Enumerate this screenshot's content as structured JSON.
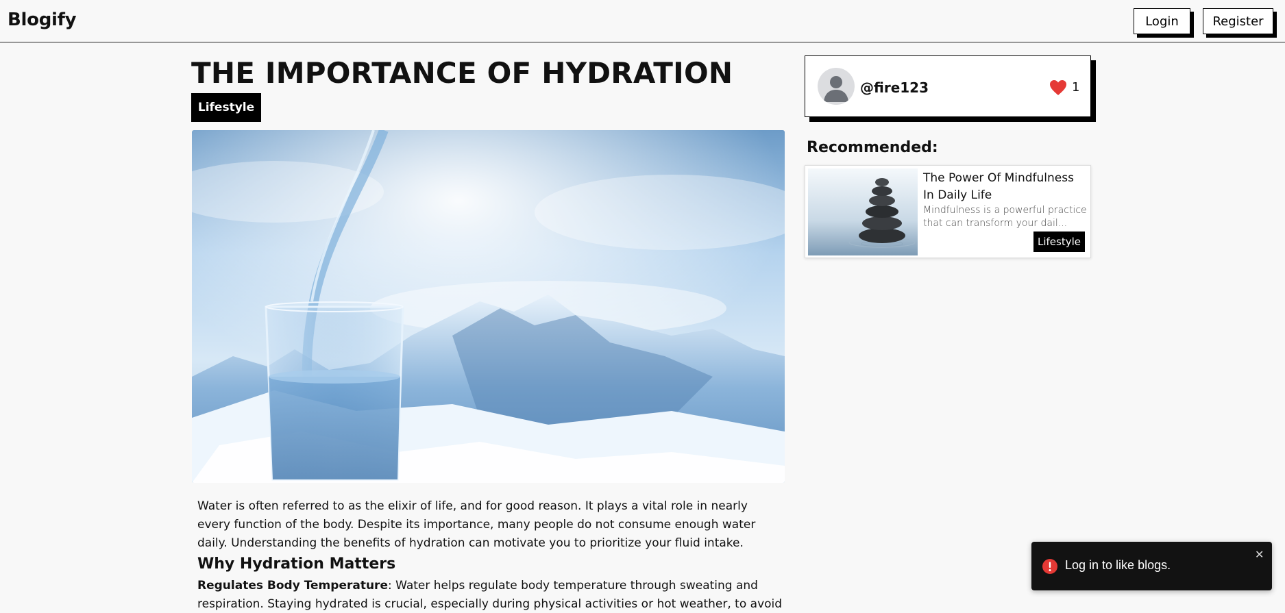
{
  "header": {
    "brand": "Blogify",
    "login_label": "Login",
    "register_label": "Register"
  },
  "article": {
    "title": "THE IMPORTANCE OF HYDRATION",
    "category": "Lifestyle",
    "hero_alt": "Water pouring into a glass in front of snowy mountains",
    "intro": "Water is often referred to as the elixir of life, and for good reason. It plays a vital role in nearly every function of the body. Despite its importance, many people do not consume enough water daily. Understanding the benefits of hydration can motivate you to prioritize your fluid intake.",
    "section_heading": "Why Hydration Matters",
    "point_label": "Regulates Body Temperature",
    "point_text": ": Water helps regulate body temperature through sweating and respiration. Staying hydrated is crucial, especially during physical activities or hot weather, to avoid overheating."
  },
  "author": {
    "username": "@fire123",
    "avatar_icon": "user-avatar-icon",
    "like_icon": "heart-icon",
    "like_color": "#e53935",
    "likes": "1"
  },
  "recommended": {
    "heading": "Recommended:",
    "items": [
      {
        "title": "The Power Of Mindfulness In Daily Life",
        "excerpt": "Mindfulness is a powerful practice that can transform your dail...",
        "category": "Lifestyle",
        "thumb_alt": "Stacked stones balanced above calm water"
      }
    ]
  },
  "toast": {
    "message": "Log in to like blogs.",
    "icon": "error-icon",
    "icon_color": "#e53935",
    "close_glyph": "✕"
  }
}
